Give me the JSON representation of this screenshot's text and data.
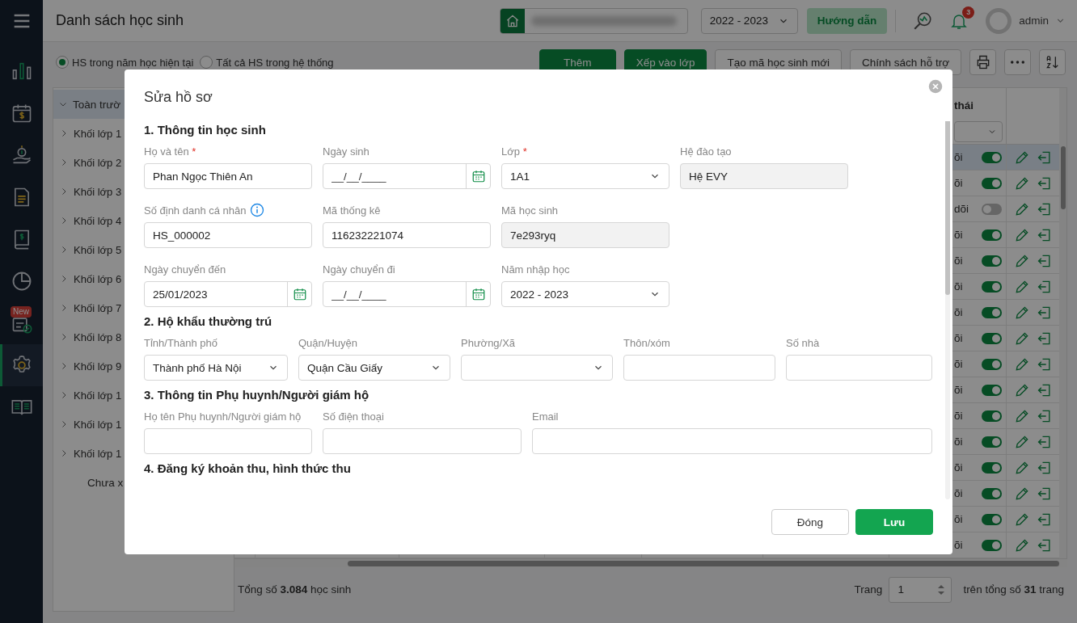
{
  "sidebar": {
    "items": [
      {
        "kind": "menu",
        "selected": false
      },
      {
        "kind": "chart",
        "selected": false
      },
      {
        "kind": "calendar-money",
        "selected": false
      },
      {
        "kind": "money-hand",
        "selected": false
      },
      {
        "kind": "document",
        "selected": false
      },
      {
        "kind": "book-money",
        "selected": false
      },
      {
        "kind": "pie",
        "selected": false
      },
      {
        "kind": "checklist",
        "selected": false,
        "badge": "New"
      },
      {
        "kind": "settings",
        "selected": true
      },
      {
        "kind": "book",
        "selected": false
      }
    ]
  },
  "header": {
    "title": "Danh sách học sinh",
    "school_year": "2022 - 2023",
    "guide_button": "Hướng dẫn",
    "notification_count": "3",
    "user": "admin"
  },
  "filters": [
    {
      "label": "HS trong năm học hiện tại",
      "selected": true
    },
    {
      "label": "Tất cả HS trong hệ thống",
      "selected": false
    }
  ],
  "toolbar": [
    {
      "kind": "primary",
      "label": "Thêm"
    },
    {
      "kind": "primary",
      "label": "Xếp vào lớp"
    },
    {
      "kind": "default",
      "label": "Tạo mã học sinh mới"
    },
    {
      "kind": "default",
      "label": "Chính sách hỗ trợ"
    },
    {
      "kind": "print"
    },
    {
      "kind": "more"
    },
    {
      "kind": "sort"
    }
  ],
  "tree": {
    "items": [
      {
        "label": "Toàn trườ",
        "expanded": true,
        "selected": true,
        "children": [
          {
            "label": "Khối lớp 1",
            "expanded": false,
            "selected": false
          },
          {
            "label": "Khối lớp 2",
            "expanded": false,
            "selected": false
          },
          {
            "label": "Khối lớp 3",
            "expanded": false,
            "selected": false
          },
          {
            "label": "Khối lớp 4",
            "expanded": false,
            "selected": false
          },
          {
            "label": "Khối lớp 5",
            "expanded": false,
            "selected": false
          },
          {
            "label": "Khối lớp 6",
            "expanded": false,
            "selected": false
          },
          {
            "label": "Khối lớp 7",
            "expanded": false,
            "selected": false
          },
          {
            "label": "Khối lớp 8",
            "expanded": false,
            "selected": false
          },
          {
            "label": "Khối lớp 9",
            "expanded": false,
            "selected": false
          },
          {
            "label": "Khối lớp 1",
            "expanded": false,
            "selected": false
          },
          {
            "label": "Khối lớp 1",
            "expanded": false,
            "selected": false
          },
          {
            "label": "Khối lớp 1",
            "expanded": false,
            "selected": false
          }
        ]
      }
    ],
    "bottom_item": "Chưa x"
  },
  "table": {
    "status_header": "thái",
    "rows": [
      {
        "status": "õi",
        "following": true,
        "selected": true
      },
      {
        "status": "õi",
        "following": true,
        "selected": false
      },
      {
        "status": "dõi",
        "following": false,
        "selected": false
      },
      {
        "status": "õi",
        "following": true,
        "selected": false
      },
      {
        "status": "õi",
        "following": true,
        "selected": false
      },
      {
        "status": "õi",
        "following": true,
        "selected": false
      },
      {
        "status": "õi",
        "following": true,
        "selected": false
      },
      {
        "status": "õi",
        "following": true,
        "selected": false
      },
      {
        "status": "õi",
        "following": true,
        "selected": false
      },
      {
        "status": "õi",
        "following": true,
        "selected": false
      },
      {
        "status": "õi",
        "following": true,
        "selected": false
      },
      {
        "status": "õi",
        "following": true,
        "selected": false
      },
      {
        "status": "õi",
        "following": true,
        "selected": false
      },
      {
        "status": "õi",
        "following": true,
        "selected": false
      },
      {
        "status": "õi",
        "following": true,
        "selected": false
      },
      {
        "status": "õi",
        "following": true,
        "selected": false
      }
    ],
    "total": "Tổng số **3.084** học sinh",
    "page_label": "Trang",
    "page": "1",
    "page_total": "trên tổng số **31** trang"
  },
  "modal": {
    "title": "Sửa hồ sơ",
    "required_mark": "*",
    "sections": [
      {
        "title": "1. Thông tin học sinh",
        "rows": [
          [
            {
              "label": "Họ và tên",
              "kind": "text",
              "value": "Phan Ngọc Thiên An",
              "required": true,
              "info": false,
              "disabled": false
            },
            {
              "label": "Ngày sinh",
              "kind": "date",
              "placeholder": "__/__/____",
              "required": false,
              "info": false,
              "disabled": false
            },
            {
              "label": "Lớp",
              "kind": "select",
              "value": "1A1",
              "required": true,
              "info": false,
              "disabled": false
            },
            {
              "label": "Hệ đào tạo",
              "kind": "text",
              "value": "Hệ EVY",
              "required": false,
              "info": false,
              "disabled": true
            }
          ],
          [
            {
              "label": "Số định danh cá nhân",
              "kind": "text",
              "value": "HS_000002",
              "required": false,
              "info": true,
              "disabled": false
            },
            {
              "label": "Mã thống kê",
              "kind": "text",
              "value": "116232221074",
              "required": false,
              "info": false,
              "disabled": false
            },
            {
              "label": "Mã học sinh",
              "kind": "text",
              "value": "7e293ryq",
              "required": false,
              "info": false,
              "disabled": true
            }
          ],
          [
            {
              "label": "Ngày chuyển đến",
              "kind": "date",
              "value": "25/01/2023",
              "required": false,
              "info": false,
              "disabled": false
            },
            {
              "label": "Ngày chuyển đi",
              "kind": "date",
              "placeholder": "__/__/____",
              "required": false,
              "info": false,
              "disabled": false
            },
            {
              "label": "Năm nhập học",
              "kind": "select",
              "value": "2022 - 2023",
              "required": false,
              "info": false,
              "disabled": false
            }
          ]
        ]
      },
      {
        "title": "2. Hộ khẩu thường trú",
        "rows": [
          [
            {
              "label": "Tỉnh/Thành phố",
              "kind": "select",
              "value": "Thành phố Hà Nội",
              "required": false,
              "info": false,
              "disabled": false
            },
            {
              "label": "Quận/Huyện",
              "kind": "select",
              "value": "Quận Cầu Giấy",
              "required": false,
              "info": false,
              "disabled": false
            },
            {
              "label": "Phường/Xã",
              "kind": "select",
              "required": false,
              "info": false,
              "disabled": false
            },
            {
              "label": "Thôn/xóm",
              "kind": "text",
              "required": false,
              "info": false,
              "disabled": false
            },
            {
              "label": "Số nhà",
              "kind": "text",
              "required": false,
              "info": false,
              "disabled": false
            }
          ]
        ]
      },
      {
        "title": "3. Thông tin Phụ huynh/Người giám hộ",
        "rows": [
          [
            {
              "label": "Họ tên Phụ huynh/Người giám hộ",
              "kind": "text",
              "required": false,
              "info": false,
              "disabled": false
            },
            {
              "label": "Số điện thoại",
              "kind": "text",
              "required": false,
              "info": false,
              "disabled": false
            },
            {
              "label": "Email",
              "kind": "text",
              "required": false,
              "info": false,
              "disabled": false
            }
          ]
        ]
      },
      {
        "title": "4. Đăng ký khoản thu, hình thức thu"
      }
    ],
    "buttons": [
      {
        "kind": "secondary",
        "label": "Đóng"
      },
      {
        "kind": "primary",
        "label": "Lưu"
      }
    ]
  }
}
